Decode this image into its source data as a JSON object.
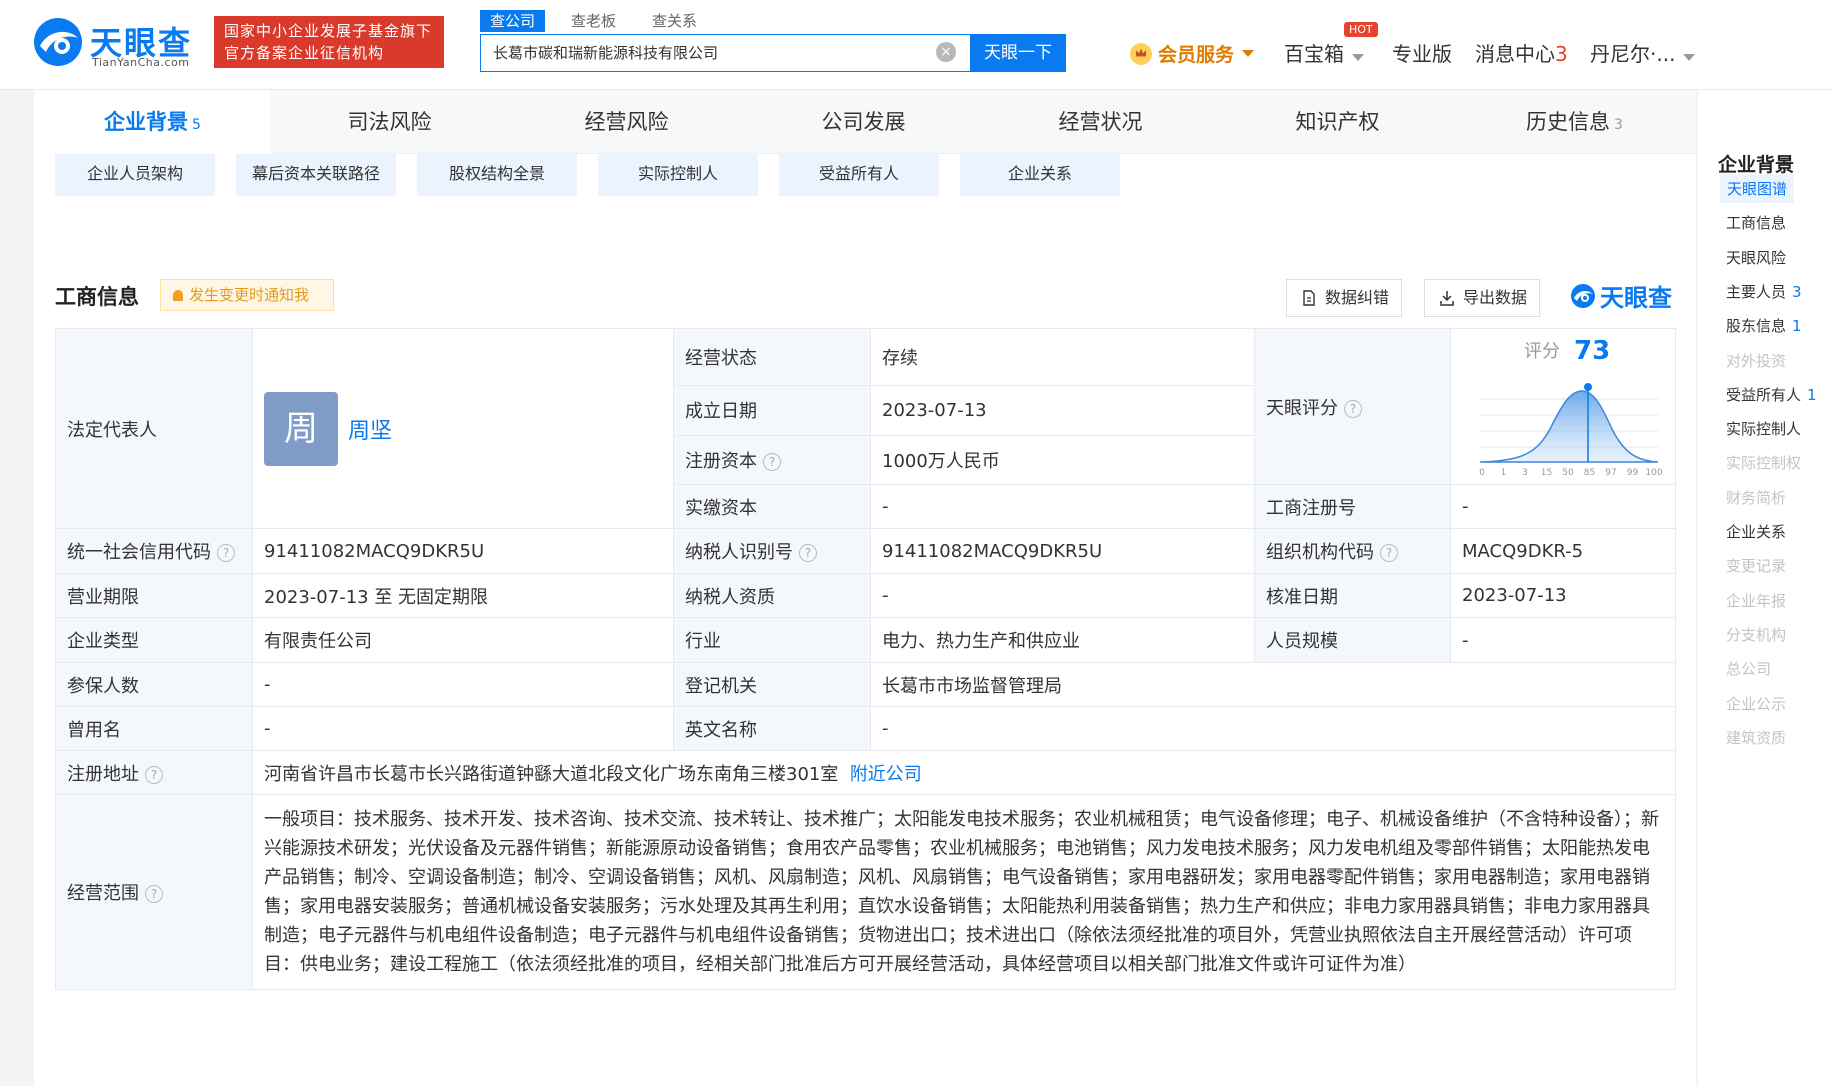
{
  "header": {
    "logo_cn": "天眼查",
    "logo_en": "TianYanCha.com",
    "badge_line1": "国家中小企业发展子基金旗下",
    "badge_line2": "官方备案企业征信机构",
    "search_tabs": [
      "查公司",
      "查老板",
      "查关系"
    ],
    "search_value": "长葛市碳和瑞新能源科技有限公司",
    "search_button": "天眼一下",
    "vip_label": "会员服务",
    "baibaoxiang": "百宝箱",
    "hot_badge": "HOT",
    "pro_label": "专业版",
    "msg_label": "消息中心",
    "msg_count": "3",
    "user_label": "丹尼尔·..."
  },
  "main_tabs": [
    {
      "label": "企业背景",
      "count": "5"
    },
    {
      "label": "司法风险",
      "count": ""
    },
    {
      "label": "经营风险",
      "count": ""
    },
    {
      "label": "公司发展",
      "count": ""
    },
    {
      "label": "经营状况",
      "count": ""
    },
    {
      "label": "知识产权",
      "count": ""
    },
    {
      "label": "历史信息",
      "count": "3"
    }
  ],
  "sub_buttons": [
    "企业人员架构",
    "幕后资本关联路径",
    "股权结构全景",
    "实际控制人",
    "受益所有人",
    "企业关系"
  ],
  "section": {
    "title": "工商信息",
    "notify": "发生变更时通知我",
    "correct_btn": "数据纠错",
    "export_btn": "导出数据",
    "brand": "天眼查"
  },
  "info": {
    "legal_rep_label": "法定代表人",
    "legal_rep_avatar": "周",
    "legal_rep_name": "周坚",
    "status_label": "经营状态",
    "status_value": "存续",
    "found_label": "成立日期",
    "found_value": "2023-07-13",
    "capital_label": "注册资本",
    "capital_value": "1000万人民币",
    "paid_label": "实缴资本",
    "paid_value": "-",
    "score_label": "天眼评分",
    "score_prefix": "评分",
    "score_value": "73",
    "score_ticks": [
      "0",
      "1",
      "3",
      "15",
      "50",
      "85",
      "97",
      "99",
      "100"
    ],
    "regno_label": "工商注册号",
    "regno_value": "-",
    "credit_label": "统一社会信用代码",
    "credit_value": "91411082MACQ9DKR5U",
    "tax_label": "纳税人识别号",
    "tax_value": "91411082MACQ9DKR5U",
    "org_label": "组织机构代码",
    "org_value": "MACQ9DKR-5",
    "term_label": "营业期限",
    "term_value": "2023-07-13 至 无固定期限",
    "taxqual_label": "纳税人资质",
    "taxqual_value": "-",
    "approve_label": "核准日期",
    "approve_value": "2023-07-13",
    "type_label": "企业类型",
    "type_value": "有限责任公司",
    "industry_label": "行业",
    "industry_value": "电力、热力生产和供应业",
    "staff_label": "人员规模",
    "staff_value": "-",
    "insured_label": "参保人数",
    "insured_value": "-",
    "authority_label": "登记机关",
    "authority_value": "长葛市市场监督管理局",
    "former_label": "曾用名",
    "former_value": "-",
    "english_label": "英文名称",
    "english_value": "-",
    "address_label": "注册地址",
    "address_value": "河南省许昌市长葛市长兴路街道钟繇大道北段文化广场东南角三楼301室",
    "nearby_link": "附近公司",
    "scope_label": "经营范围",
    "scope_value": "一般项目：技术服务、技术开发、技术咨询、技术交流、技术转让、技术推广；太阳能发电技术服务；农业机械租赁；电气设备修理；电子、机械设备维护（不含特种设备）；新兴能源技术研发；光伏设备及元器件销售；新能源原动设备销售；食用农产品零售；农业机械服务；电池销售；风力发电技术服务；风力发电机组及零部件销售；太阳能热发电产品销售；制冷、空调设备制造；制冷、空调设备销售；风机、风扇制造；风机、风扇销售；电气设备销售；家用电器研发；家用电器零配件销售；家用电器制造；家用电器销售；家用电器安装服务；普通机械设备安装服务；污水处理及其再生利用；直饮水设备销售；太阳能热利用装备销售；热力生产和供应；非电力家用器具销售；非电力家用器具制造；电子元器件与机电组件设备制造；电子元器件与机电组件设备销售；货物进出口；技术进出口（除依法须经批准的项目外，凭营业执照依法自主开展经营活动）许可项目：供电业务；建设工程施工（依法须经批准的项目，经相关部门批准后方可开展经营活动，具体经营项目以相关部门批准文件或许可证件为准）"
  },
  "sidebar": {
    "title": "企业背景",
    "items": [
      {
        "label": "天眼图谱",
        "count": "",
        "state": "active"
      },
      {
        "label": "工商信息",
        "count": "",
        "state": "normal"
      },
      {
        "label": "天眼风险",
        "count": "",
        "state": "normal"
      },
      {
        "label": "主要人员",
        "count": "3",
        "state": "normal"
      },
      {
        "label": "股东信息",
        "count": "1",
        "state": "normal"
      },
      {
        "label": "对外投资",
        "count": "",
        "state": "dim"
      },
      {
        "label": "受益所有人",
        "count": "1",
        "state": "normal"
      },
      {
        "label": "实际控制人",
        "count": "",
        "state": "normal"
      },
      {
        "label": "实际控制权",
        "count": "",
        "state": "dim"
      },
      {
        "label": "财务简析",
        "count": "",
        "state": "dim"
      },
      {
        "label": "企业关系",
        "count": "",
        "state": "normal"
      },
      {
        "label": "变更记录",
        "count": "",
        "state": "dim"
      },
      {
        "label": "企业年报",
        "count": "",
        "state": "dim"
      },
      {
        "label": "分支机构",
        "count": "",
        "state": "dim"
      },
      {
        "label": "总公司",
        "count": "",
        "state": "dim"
      },
      {
        "label": "企业公示",
        "count": "",
        "state": "dim"
      },
      {
        "label": "建筑资质",
        "count": "",
        "state": "dim"
      }
    ]
  },
  "colors": {
    "brand_blue": "#0a7af0",
    "badge_red": "#d93a2b",
    "vip_orange": "#e07b00"
  }
}
